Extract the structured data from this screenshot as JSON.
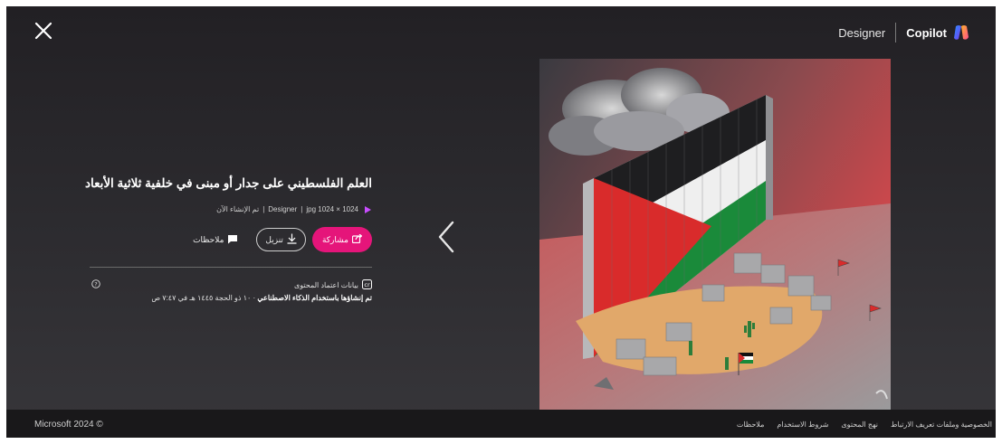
{
  "header": {
    "designer_label": "Designer",
    "copilot_label": "Copilot"
  },
  "image_info": {
    "title": "العلم الفلسطيني على جدار أو مبنى في خلفية ثلاثية الأبعاد",
    "meta_size": "1024 × 1024 jpg",
    "meta_app": "Designer",
    "meta_sep": "|",
    "meta_created": "تم الإنشاء الآن"
  },
  "actions": {
    "share_label": "مشاركة",
    "download_label": "تنزيل",
    "feedback_label": "ملاحظات"
  },
  "credentials": {
    "label": "بيانات اعتماد المحتوى",
    "created_bold": "تم إنشاؤها باستخدام الذكاء الاصطناعي",
    "created_date": " · ١٠ ذو الحجة ١٤٤٥ هـ في ٧:٤٧ ص"
  },
  "footer": {
    "copyright": "Microsoft 2024 ©",
    "links": [
      "الخصوصية وملفات تعريف الارتباط",
      "نهج المحتوى",
      "شروط الاستخدام",
      "ملاحظات"
    ]
  },
  "icons": {
    "close": "close-icon",
    "copilot_logo": "copilot-logo-icon",
    "designer_dot": "designer-icon",
    "share": "share-icon",
    "download": "download-icon",
    "feedback": "chat-bubble-icon",
    "credentials": "content-credentials-icon",
    "help": "help-circle-icon",
    "previous": "chevron-left-icon"
  },
  "colors": {
    "accent_pink": "#e5157a",
    "background": "#2b2a2e",
    "footer_bg": "#19181a"
  }
}
